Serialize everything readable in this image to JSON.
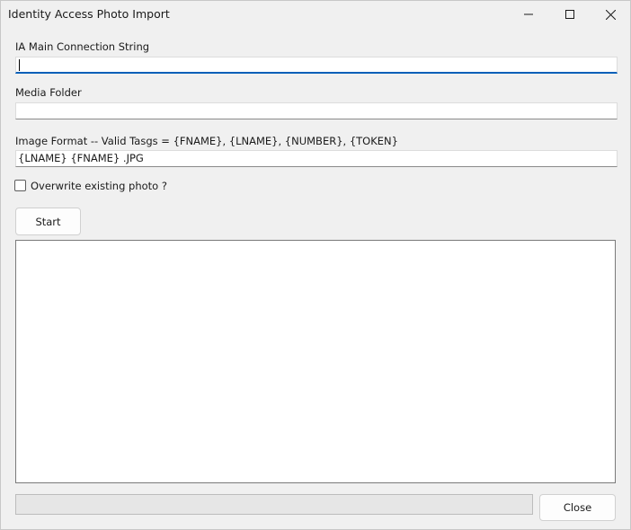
{
  "window": {
    "title": "Identity Access Photo Import",
    "controls": [
      "minimize-icon",
      "maximize-icon",
      "close-icon"
    ]
  },
  "form": {
    "connection_label": "IA Main Connection String",
    "connection_value": "",
    "media_label": "Media Folder",
    "media_value": "",
    "format_label": "Image Format -- Valid Tasgs =  {FNAME}, {LNAME}, {NUMBER}, {TOKEN}",
    "format_value": "{LNAME} {FNAME} .JPG",
    "overwrite_label": "Overwrite existing photo ?",
    "overwrite_checked": false
  },
  "buttons": {
    "start_label": "Start",
    "close_label": "Close"
  },
  "log": {
    "text": ""
  },
  "progress": {
    "value": 0
  },
  "colors": {
    "background": "#f0f0f0",
    "focus_accent": "#005fb8",
    "progress_fill": "#06b025"
  }
}
